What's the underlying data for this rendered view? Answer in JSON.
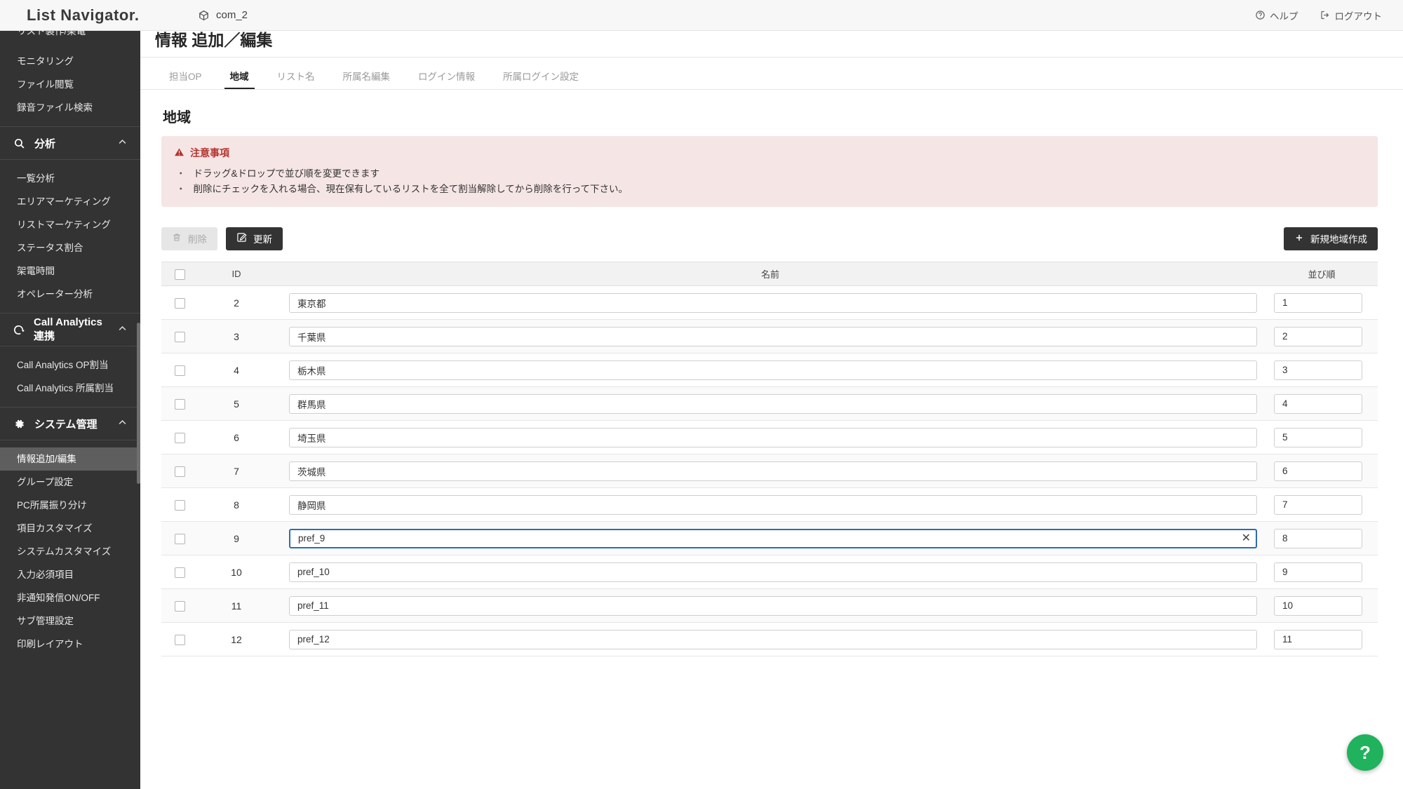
{
  "topbar": {
    "brand": "List Navigator.",
    "company": "com_2",
    "company_icon": "cube-icon",
    "help_label": "ヘルプ",
    "help_icon": "question-circle-icon",
    "logout_label": "ログアウト",
    "logout_icon": "logout-icon"
  },
  "sidebar": {
    "top_items": [
      {
        "label": "リスト製作/架電"
      },
      {
        "label": "モニタリング"
      },
      {
        "label": "ファイル閲覧"
      },
      {
        "label": "録音ファイル検索"
      }
    ],
    "sections": [
      {
        "title": "分析",
        "icon": "search-icon",
        "chevron": "chevron-up-icon",
        "items": [
          {
            "label": "一覧分析"
          },
          {
            "label": "エリアマーケティング"
          },
          {
            "label": "リストマーケティング"
          },
          {
            "label": "ステータス割合"
          },
          {
            "label": "架電時間"
          },
          {
            "label": "オペレーター分析"
          }
        ]
      },
      {
        "title": "Call Analytics 連携",
        "icon": "call-analytics-icon",
        "chevron": "chevron-up-icon",
        "items": [
          {
            "label": "Call Analytics OP割当"
          },
          {
            "label": "Call Analytics 所属割当"
          }
        ]
      },
      {
        "title": "システム管理",
        "icon": "gear-icon",
        "chevron": "chevron-up-icon",
        "items": [
          {
            "label": "情報追加/編集",
            "active": true
          },
          {
            "label": "グループ設定"
          },
          {
            "label": "PC所属振り分け"
          },
          {
            "label": "項目カスタマイズ"
          },
          {
            "label": "システムカスタマイズ"
          },
          {
            "label": "入力必須項目"
          },
          {
            "label": "非通知発信ON/OFF"
          },
          {
            "label": "サブ管理設定"
          },
          {
            "label": "印刷レイアウト"
          }
        ]
      }
    ]
  },
  "page": {
    "title": "情報 追加／編集",
    "tabs": [
      {
        "label": "担当OP",
        "active": false
      },
      {
        "label": "地域",
        "active": true
      },
      {
        "label": "リスト名",
        "active": false
      },
      {
        "label": "所属名編集",
        "active": false
      },
      {
        "label": "ログイン情報",
        "active": false
      },
      {
        "label": "所属ログイン設定",
        "active": false
      }
    ],
    "section_title": "地域",
    "notice": {
      "icon": "warning-triangle-icon",
      "heading": "注意事項",
      "items": [
        "ドラッグ&ドロップで並び順を変更できます",
        "削除にチェックを入れる場合、現在保有しているリストを全て割当解除してから削除を行って下さい。"
      ]
    },
    "toolbar": {
      "delete_label": "削除",
      "delete_icon": "trash-icon",
      "delete_disabled": true,
      "update_label": "更新",
      "update_icon": "edit-pencil-icon",
      "new_label": "新規地域作成",
      "new_icon": "plus-icon"
    },
    "table": {
      "headers": {
        "checkbox": "",
        "id": "ID",
        "name": "名前",
        "order": "並び順"
      },
      "rows": [
        {
          "id": "2",
          "name": "東京都",
          "order": "1",
          "focused": false
        },
        {
          "id": "3",
          "name": "千葉県",
          "order": "2",
          "focused": false
        },
        {
          "id": "4",
          "name": "栃木県",
          "order": "3",
          "focused": false
        },
        {
          "id": "5",
          "name": "群馬県",
          "order": "4",
          "focused": false
        },
        {
          "id": "6",
          "name": "埼玉県",
          "order": "5",
          "focused": false
        },
        {
          "id": "7",
          "name": "茨城県",
          "order": "6",
          "focused": false
        },
        {
          "id": "8",
          "name": "静岡県",
          "order": "7",
          "focused": false
        },
        {
          "id": "9",
          "name": "pref_9",
          "order": "8",
          "focused": true
        },
        {
          "id": "10",
          "name": "pref_10",
          "order": "9",
          "focused": false
        },
        {
          "id": "11",
          "name": "pref_11",
          "order": "10",
          "focused": false
        },
        {
          "id": "12",
          "name": "pref_12",
          "order": "11",
          "focused": false
        }
      ]
    },
    "fab": {
      "icon": "question-mark-icon",
      "label": "?"
    }
  },
  "colors": {
    "sidebar_bg": "#333333",
    "sidebar_active": "#5e5e5e",
    "accent_dark": "#333333",
    "notice_bg": "#f6e5e5",
    "notice_text": "#b2352f",
    "focus_border": "#2b6cb5",
    "fab_green": "#20b25c"
  }
}
